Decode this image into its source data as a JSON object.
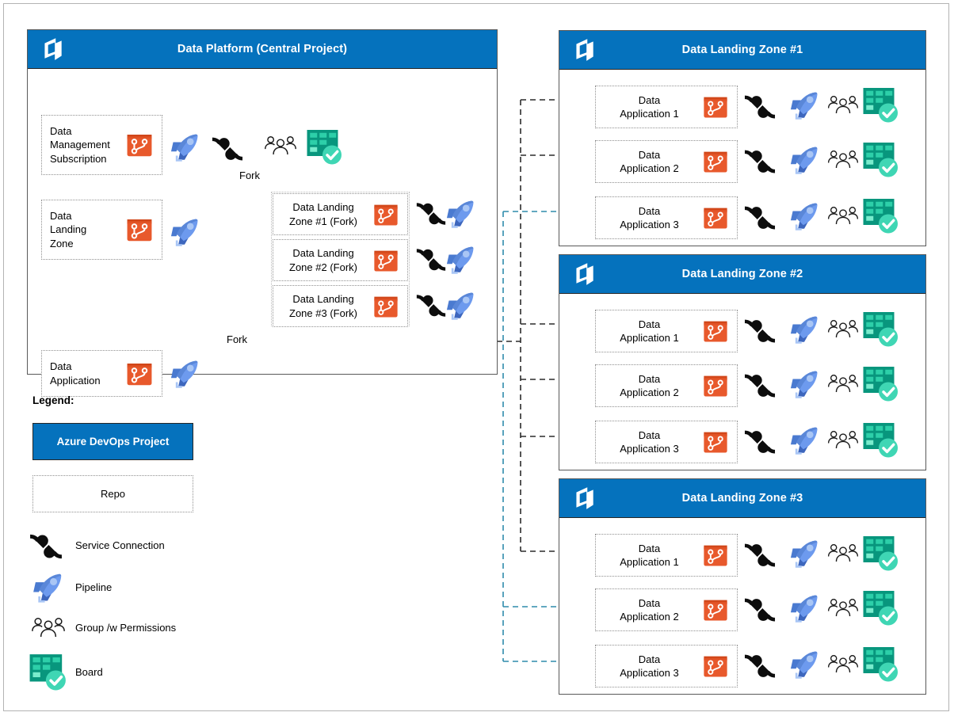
{
  "diagram": {
    "title_hidden": "Azure DevOps data platform project structure"
  },
  "central_project": {
    "title": "Data Platform (Central Project)",
    "logo_icon": "azure-devops-logo-icon",
    "repos": [
      {
        "label": "Data\nManagement\nSubscription",
        "icons": [
          "repo-icon",
          "pipeline-icon",
          "service-connection-icon",
          "group-permissions-icon",
          "board-icon"
        ]
      },
      {
        "label": "Data\nLanding\nZone",
        "icons": [
          "repo-icon",
          "pipeline-icon"
        ]
      },
      {
        "label": "Data\nApplication",
        "icons": [
          "repo-icon",
          "pipeline-icon"
        ]
      }
    ],
    "fork_repos": [
      {
        "label": "Data Landing\nZone #1 (Fork)",
        "icons": [
          "repo-icon",
          "service-connection-icon",
          "pipeline-icon"
        ]
      },
      {
        "label": "Data Landing\nZone #2 (Fork)",
        "icons": [
          "repo-icon",
          "service-connection-icon",
          "pipeline-icon"
        ]
      },
      {
        "label": "Data Landing\nZone #3 (Fork)",
        "icons": [
          "repo-icon",
          "service-connection-icon",
          "pipeline-icon"
        ]
      }
    ],
    "fork_label_top": "Fork",
    "fork_label_bottom": "Fork"
  },
  "landing_zones": [
    {
      "title": "Data Landing Zone #1",
      "logo_icon": "azure-devops-logo-icon",
      "apps": [
        {
          "label": "Data\nApplication 1"
        },
        {
          "label": "Data\nApplication 2"
        },
        {
          "label": "Data\nApplication 3"
        }
      ]
    },
    {
      "title": "Data Landing Zone #2",
      "logo_icon": "azure-devops-logo-icon",
      "apps": [
        {
          "label": "Data\nApplication 1"
        },
        {
          "label": "Data\nApplication 2"
        },
        {
          "label": "Data\nApplication 3"
        }
      ]
    },
    {
      "title": "Data Landing Zone #3",
      "logo_icon": "azure-devops-logo-icon",
      "apps": [
        {
          "label": "Data\nApplication 1"
        },
        {
          "label": "Data\nApplication 2"
        },
        {
          "label": "Data\nApplication 3"
        }
      ]
    }
  ],
  "legend": {
    "title": "Legend:",
    "project_label": "Azure DevOps Project",
    "repo_label": "Repo",
    "items": [
      {
        "icon": "service-connection-icon",
        "label": "Service Connection"
      },
      {
        "icon": "pipeline-icon",
        "label": "Pipeline"
      },
      {
        "icon": "group-permissions-icon",
        "label": "Group /w Permissions"
      },
      {
        "icon": "board-icon",
        "label": "Board"
      }
    ]
  },
  "colors": {
    "devops_blue": "#0572bd",
    "repo_orange": "#e8592c",
    "repo_orange_dark": "#d44a1b",
    "pipeline_blue": "#5a87d8",
    "pipeline_blue_dark": "#3b63b8",
    "board_teal": "#08967d",
    "board_teal_light": "#5fe0c0",
    "connector_black": "#2b2b2b",
    "connector_teal": "#2e8bac",
    "panel_border": "#595959",
    "dotted_border": "#909090"
  }
}
